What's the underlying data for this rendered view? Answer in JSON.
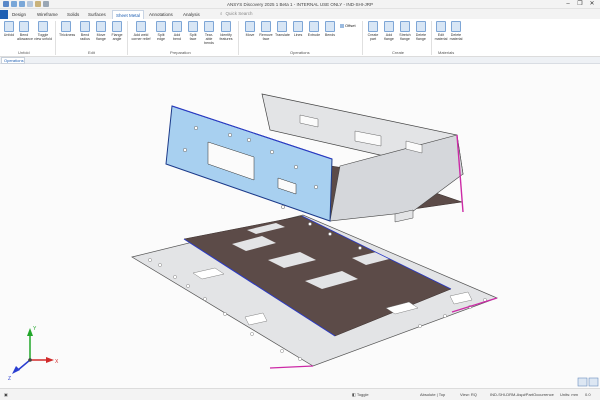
{
  "titlebar": {
    "title": "ANSYS Discovery 2025 1 Beta 1 - INTERNAL USE ONLY - IND-SHI-JRP",
    "controls": [
      "–",
      "❐",
      "✕"
    ]
  },
  "quick_access": {
    "icons": [
      "save-icon",
      "undo-icon",
      "redo-icon",
      "copy-icon",
      "paste-icon",
      "print-icon"
    ]
  },
  "tabs": [
    "",
    "Design",
    "Wireframe",
    "Solids",
    "Surfaces",
    "Sheet Metal",
    "Annotations",
    "Analysis"
  ],
  "tell_me": "Quick Search",
  "ribbon": {
    "unfold_buttons": [
      "Unfold",
      "Bend allowance",
      "Toggle view unfold"
    ],
    "edit_buttons": [
      "Thickness",
      "Bend radius",
      "Move flange",
      "Flange angle"
    ],
    "preparation_buttons": [
      "Add weld corner relief",
      "Split edge",
      "Add bend",
      "Split face",
      "Tear-able bends",
      "Identify features"
    ],
    "operations_buttons": [
      "Move",
      "Remove face",
      "Translate",
      "Lines",
      "Extrude",
      "Bends"
    ],
    "offset_label": "Offset",
    "create_buttons": [
      "Create part",
      "Add flange",
      "Stretch flange",
      "Delete flange"
    ],
    "materials_buttons": [
      "Edit material",
      "Delete material"
    ],
    "groups": [
      "Unfold",
      "Edit",
      "Preparation",
      "Operations",
      "Create",
      "Materials"
    ]
  },
  "doc_tab": "Operations",
  "axes": {
    "x": "X",
    "y": "Y",
    "z": "Z"
  },
  "status": {
    "toggle": "Toggle",
    "absolute": "Absolute | Top",
    "view": "View: RQ",
    "selection": "IND-SHI-DRM-Asp#PartOccurrence",
    "units": "Units: mm",
    "coords": "0.0"
  },
  "colors": {
    "accent": "#1e5fb3",
    "selected_face": "#a8d0f0",
    "bottom_sheet": "#5c4b48",
    "metal": "#e3e4e6",
    "edge_highlight": "#cc2aa6"
  }
}
